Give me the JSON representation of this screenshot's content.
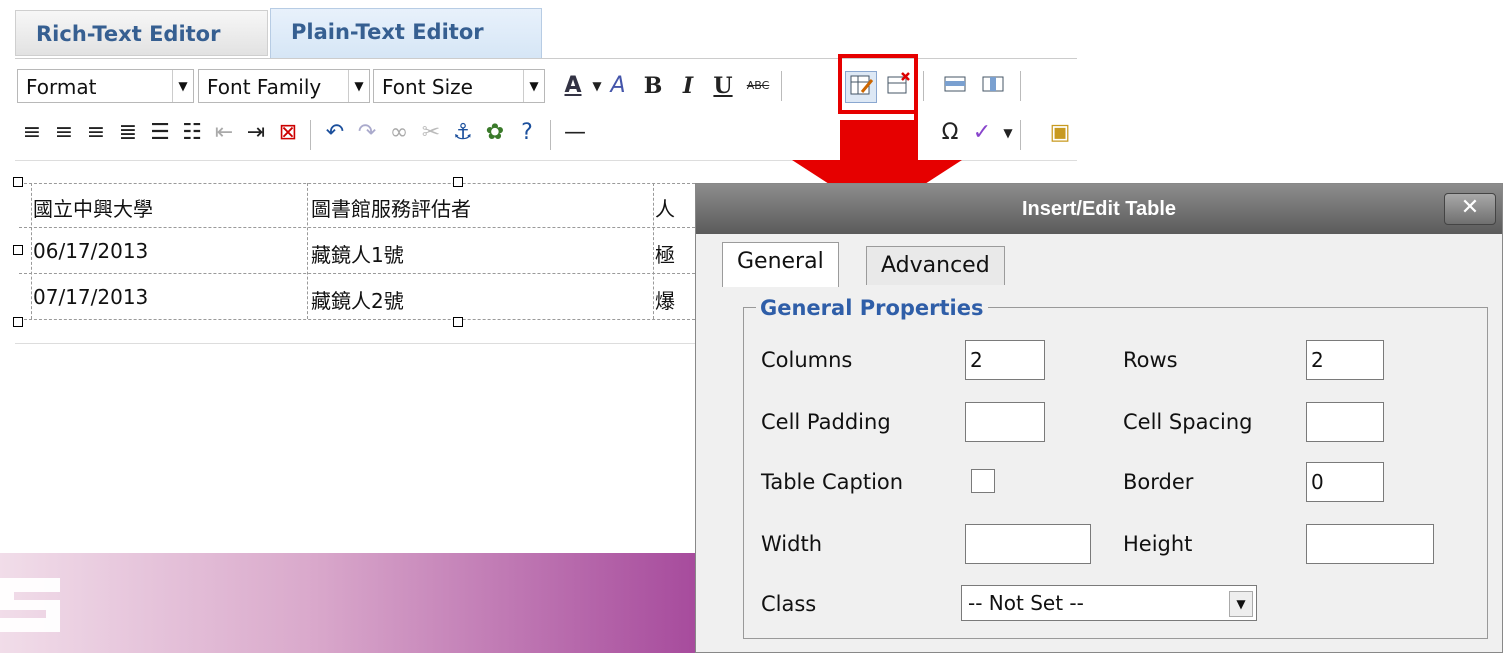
{
  "editor_tabs": {
    "rich": "Rich-Text Editor",
    "plain": "Plain-Text Editor"
  },
  "toolbar": {
    "format": "Format",
    "font_family": "Font Family",
    "font_size": "Font Size",
    "bold": "B",
    "italic": "I",
    "underline": "U",
    "spellcheck_small": "ABC"
  },
  "table_rows": [
    [
      "國立中興大學",
      "圖書館服務評估者",
      "人"
    ],
    [
      "06/17/2013",
      "藏鏡人1號",
      "極"
    ],
    [
      "07/17/2013",
      "藏鏡人2號",
      "爆"
    ]
  ],
  "dialog": {
    "title": "Insert/Edit Table",
    "close": "✕",
    "tabs": {
      "general": "General",
      "advanced": "Advanced"
    },
    "legend": "General Properties",
    "labels": {
      "columns": "Columns",
      "rows": "Rows",
      "cell_padding": "Cell Padding",
      "cell_spacing": "Cell Spacing",
      "table_caption": "Table Caption",
      "border": "Border",
      "width": "Width",
      "height": "Height",
      "class": "Class"
    },
    "values": {
      "columns": "2",
      "rows": "2",
      "cell_padding": "",
      "cell_spacing": "",
      "border": "0",
      "width": "",
      "height": "",
      "class": "-- Not Set --"
    }
  },
  "colors": {
    "highlight": "#e60000",
    "tab_text": "#365f91",
    "legend": "#2f5ea8"
  }
}
